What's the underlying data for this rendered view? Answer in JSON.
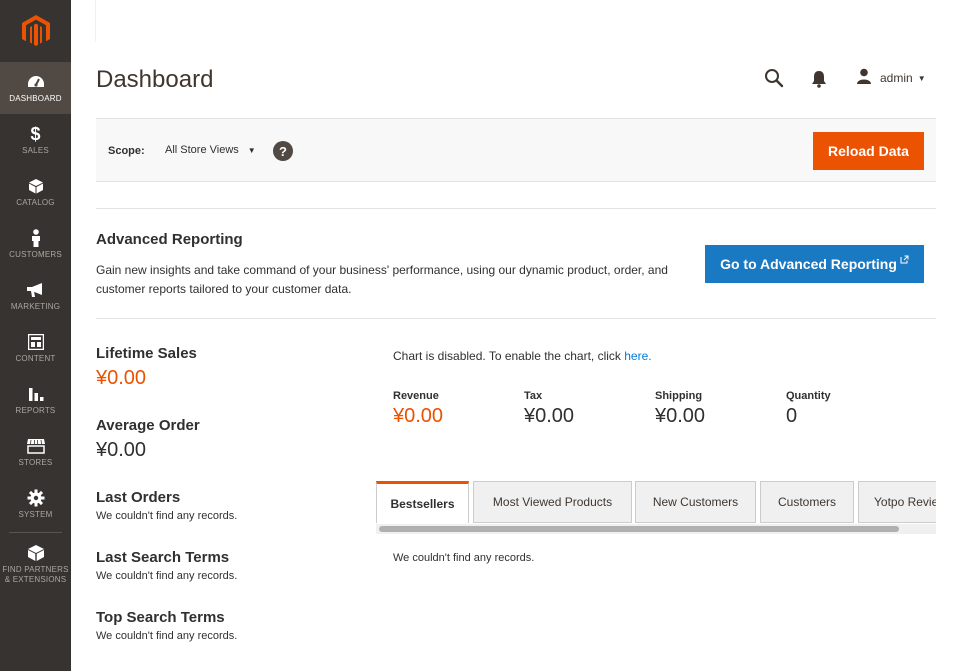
{
  "colors": {
    "accent": "#eb5202",
    "primary_button": "#1979c3",
    "sidebar_bg": "#373330",
    "sidebar_active": "#514943",
    "link": "#007bdb"
  },
  "sidebar": {
    "logo_icon": "magento-logo-icon",
    "items": [
      {
        "label": "DASHBOARD",
        "icon": "dashboard-gauge-icon",
        "active": true
      },
      {
        "label": "SALES",
        "icon": "dollar-icon"
      },
      {
        "label": "CATALOG",
        "icon": "box-icon"
      },
      {
        "label": "CUSTOMERS",
        "icon": "person-icon"
      },
      {
        "label": "MARKETING",
        "icon": "megaphone-icon"
      },
      {
        "label": "CONTENT",
        "icon": "layout-icon"
      },
      {
        "label": "REPORTS",
        "icon": "bar-chart-icon"
      },
      {
        "label": "STORES",
        "icon": "storefront-icon"
      },
      {
        "label": "SYSTEM",
        "icon": "gear-icon"
      },
      {
        "label": "FIND PARTNERS & EXTENSIONS",
        "label_line1": "FIND PARTNERS",
        "label_line2": "& EXTENSIONS",
        "icon": "package-icon"
      }
    ]
  },
  "header": {
    "title": "Dashboard",
    "search_icon": "search-icon",
    "notifications_icon": "bell-icon",
    "user": {
      "icon": "user-icon",
      "name": "admin"
    }
  },
  "scope": {
    "label": "Scope:",
    "selected": "All Store Views",
    "help": "?",
    "reload_label": "Reload Data"
  },
  "advanced_reporting": {
    "title": "Advanced Reporting",
    "text": "Gain new insights and take command of your business' performance, using our dynamic product, order, and customer reports tailored to your customer data.",
    "button_label": "Go to Advanced Reporting"
  },
  "stats": {
    "lifetime_sales": {
      "title": "Lifetime Sales",
      "value": "¥0.00"
    },
    "average_order": {
      "title": "Average Order",
      "value": "¥0.00"
    },
    "last_orders": {
      "title": "Last Orders",
      "message": "We couldn't find any records."
    },
    "last_search_terms": {
      "title": "Last Search Terms",
      "message": "We couldn't find any records."
    },
    "top_search_terms": {
      "title": "Top Search Terms",
      "message": "We couldn't find any records."
    }
  },
  "chart": {
    "message": "Chart is disabled. To enable the chart, click",
    "link": "here."
  },
  "totals": [
    {
      "label": "Revenue",
      "value": "¥0.00",
      "highlight": true
    },
    {
      "label": "Tax",
      "value": "¥0.00"
    },
    {
      "label": "Shipping",
      "value": "¥0.00"
    },
    {
      "label": "Quantity",
      "value": "0"
    }
  ],
  "tabs": [
    {
      "label": "Bestsellers",
      "active": true
    },
    {
      "label": "Most Viewed Products"
    },
    {
      "label": "New Customers"
    },
    {
      "label": "Customers"
    },
    {
      "label": "Yotpo Reviews"
    }
  ],
  "tab_content": {
    "message": "We couldn't find any records."
  }
}
